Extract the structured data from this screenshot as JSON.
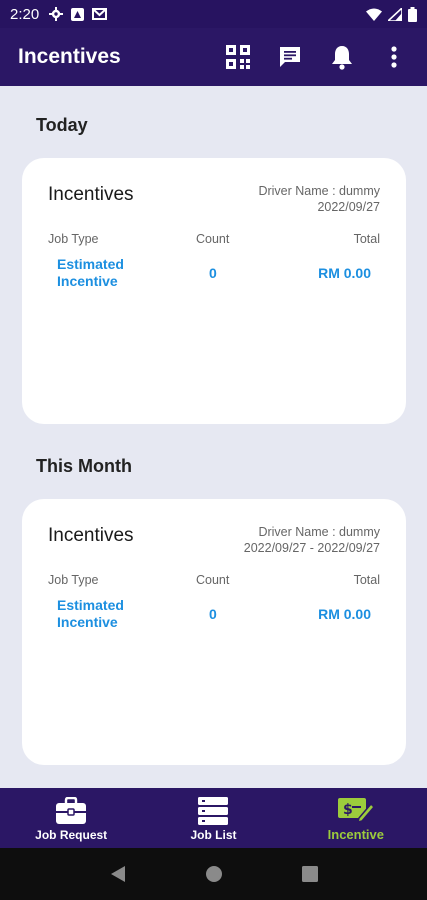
{
  "status_bar": {
    "time": "2:20"
  },
  "app_bar": {
    "title": "Incentives"
  },
  "sections": [
    {
      "title": "Today",
      "card": {
        "title": "Incentives",
        "driver": "Driver Name : dummy",
        "date": "2022/09/27",
        "headers": {
          "job_type": "Job Type",
          "count": "Count",
          "total": "Total"
        },
        "row": {
          "job_type_line1": "Estimated",
          "job_type_line2": "Incentive",
          "count": "0",
          "total": "RM 0.00"
        }
      }
    },
    {
      "title": "This Month",
      "card": {
        "title": "Incentives",
        "driver": "Driver Name : dummy",
        "date": "2022/09/27 - 2022/09/27",
        "headers": {
          "job_type": "Job Type",
          "count": "Count",
          "total": "Total"
        },
        "row": {
          "job_type_line1": "Estimated",
          "job_type_line2": "Incentive",
          "count": "0",
          "total": "RM 0.00"
        }
      }
    }
  ],
  "bottom_nav": [
    {
      "label": "Job Request",
      "icon": "briefcase-icon"
    },
    {
      "label": "Job List",
      "icon": "list-icon"
    },
    {
      "label": "Incentive",
      "icon": "incentive-icon",
      "active": true
    }
  ],
  "colors": {
    "primary": "#2b1765",
    "accent": "#1c8fe0",
    "active_nav": "#9ccc3c",
    "background": "#e6e8f2"
  }
}
